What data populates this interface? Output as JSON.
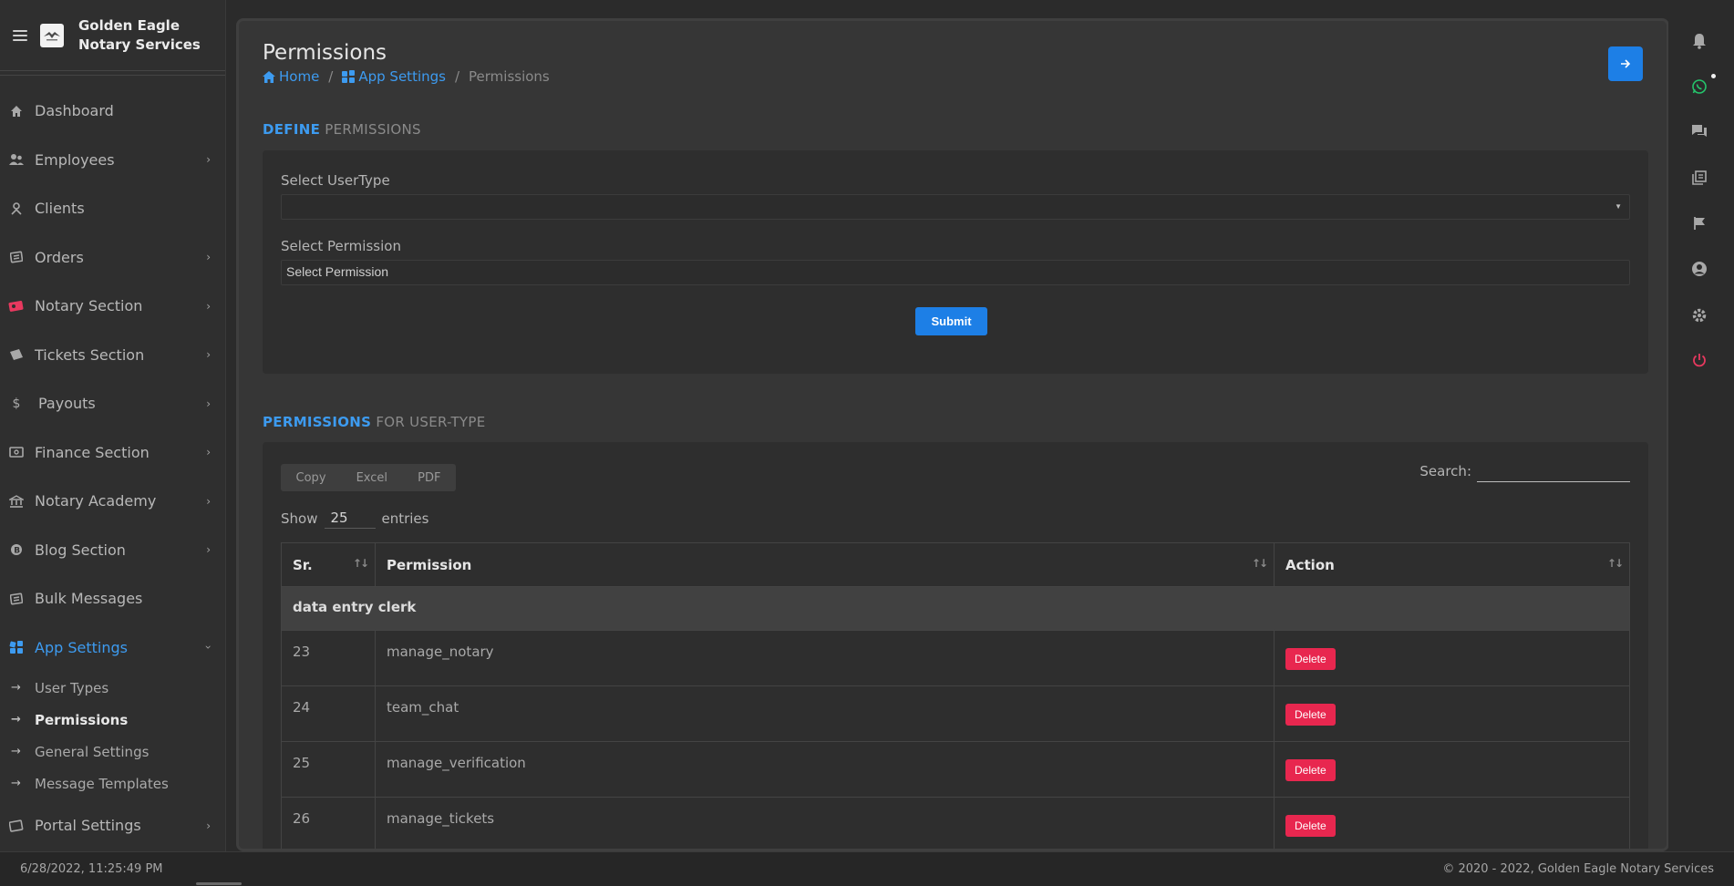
{
  "brand": {
    "name": "Golden Eagle Notary Services"
  },
  "sidebar": {
    "items": [
      {
        "label": "Dashboard",
        "icon": "home-icon",
        "chevron": false
      },
      {
        "label": "Employees",
        "icon": "users-icon",
        "chevron": true
      },
      {
        "label": "Clients",
        "icon": "user-icon",
        "chevron": false
      },
      {
        "label": "Orders",
        "icon": "orders-icon",
        "chevron": true
      },
      {
        "label": "Notary Section",
        "icon": "notary-icon",
        "chevron": true
      },
      {
        "label": "Tickets Section",
        "icon": "ticket-icon",
        "chevron": true
      },
      {
        "label": "Payouts",
        "icon": "dollar-icon",
        "chevron": true
      },
      {
        "label": "Finance Section",
        "icon": "finance-icon",
        "chevron": true
      },
      {
        "label": "Notary Academy",
        "icon": "academy-icon",
        "chevron": true
      },
      {
        "label": "Blog Section",
        "icon": "blog-icon",
        "chevron": true
      },
      {
        "label": "Bulk Messages",
        "icon": "messages-icon",
        "chevron": false
      },
      {
        "label": "App Settings",
        "icon": "settings-icon",
        "chevron": true,
        "active": true
      }
    ],
    "subitems": [
      {
        "label": "User Types"
      },
      {
        "label": "Permissions",
        "current": true
      },
      {
        "label": "General Settings"
      },
      {
        "label": "Message Templates"
      }
    ],
    "last_item": {
      "label": "Portal Settings",
      "icon": "portal-icon",
      "chevron": true
    }
  },
  "header": {
    "title": "Permissions",
    "breadcrumb": {
      "home": "Home",
      "section": "App Settings",
      "current": "Permissions",
      "separator": "/"
    }
  },
  "define_section": {
    "title_strong": "DEFINE",
    "title_muted": "PERMISSIONS",
    "usertype_label": "Select UserType",
    "usertype_value": "",
    "permission_label": "Select Permission",
    "permission_value": "Select Permission",
    "submit_label": "Submit"
  },
  "list_section": {
    "title_strong": "PERMISSIONS",
    "title_muted": "FOR USER-TYPE",
    "buttons": {
      "copy": "Copy",
      "excel": "Excel",
      "pdf": "PDF"
    },
    "search_label": "Search:",
    "show_label": "Show",
    "entries_value": "25",
    "entries_label": "entries",
    "columns": [
      "Sr.",
      "Permission",
      "Action"
    ],
    "group": "data entry clerk",
    "rows": [
      {
        "sr": "23",
        "permission": "manage_notary",
        "action": "Delete"
      },
      {
        "sr": "24",
        "permission": "team_chat",
        "action": "Delete"
      },
      {
        "sr": "25",
        "permission": "manage_verification",
        "action": "Delete"
      },
      {
        "sr": "26",
        "permission": "manage_tickets",
        "action": "Delete"
      }
    ]
  },
  "footer": {
    "datetime": "6/28/2022, 11:25:49 PM",
    "copyright": "© 2020 - 2022, Golden Eagle Notary Services"
  },
  "colors": {
    "accent": "#3d9bf0",
    "primary_button": "#1d7fe6",
    "danger": "#e8274f",
    "whatsapp": "#25c46b",
    "power": "#e8395f"
  }
}
